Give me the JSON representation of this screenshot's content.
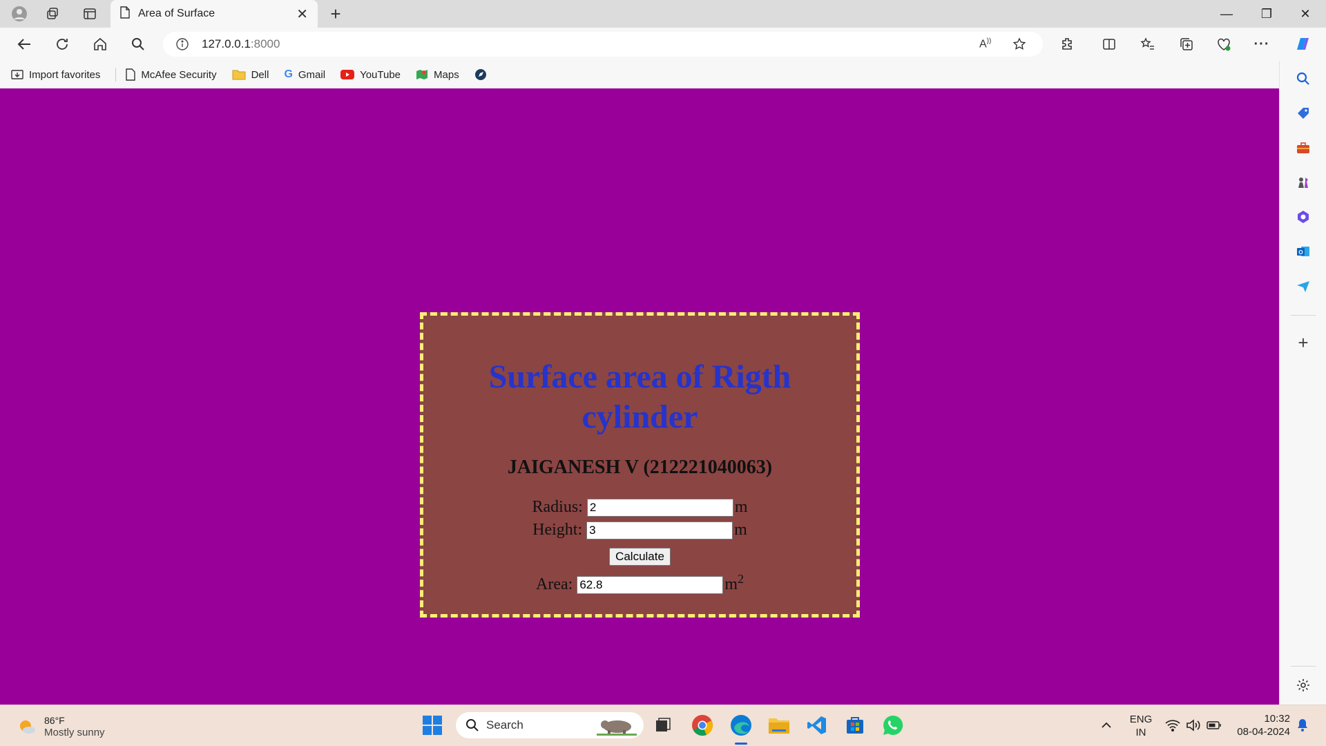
{
  "browser": {
    "tab_title": "Area of Surface",
    "url_host": "127.0.0.1",
    "url_port": ":8000"
  },
  "favorites": [
    {
      "label": "Import favorites",
      "icon": "import-favorites-icon"
    },
    {
      "label": "McAfee Security",
      "icon": "page-icon"
    },
    {
      "label": "Dell",
      "icon": "folder-icon"
    },
    {
      "label": "Gmail",
      "icon": "google-icon"
    },
    {
      "label": "YouTube",
      "icon": "youtube-icon"
    },
    {
      "label": "Maps",
      "icon": "maps-icon"
    }
  ],
  "page": {
    "heading": "Surface area of Rigth cylinder",
    "author": "JAIGANESH V (212221040063)",
    "radius_label": "Radius:",
    "radius_value": "2",
    "height_label": "Height:",
    "height_value": "3",
    "unit": "m",
    "button_label": "Calculate",
    "area_label": "Area:",
    "area_value": "62.8",
    "area_unit": "m",
    "area_unit_exp": "2",
    "colors": {
      "background": "#990099",
      "card": "#8b4543",
      "border": "#ffee77",
      "heading": "#2633cc"
    }
  },
  "taskbar": {
    "weather_temp": "86°F",
    "weather_desc": "Mostly sunny",
    "search_placeholder": "Search",
    "lang_top": "ENG",
    "lang_bottom": "IN",
    "time": "10:32",
    "date": "08-04-2024"
  }
}
